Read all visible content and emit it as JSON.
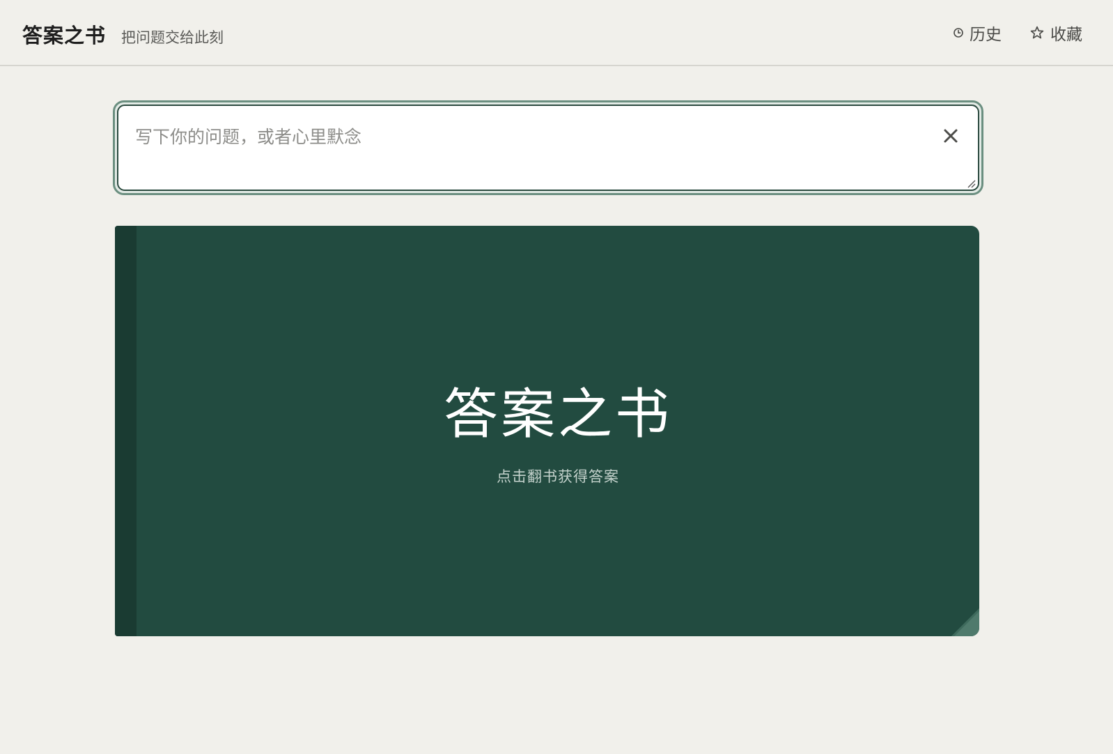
{
  "header": {
    "title": "答案之书",
    "tagline": "把问题交给此刻",
    "nav": [
      {
        "label": "历史",
        "icon": "clock-icon"
      },
      {
        "label": "收藏",
        "icon": "star-icon"
      }
    ]
  },
  "question": {
    "placeholder": "写下你的问题，或者心里默念",
    "value": "",
    "clear_icon": "close-icon"
  },
  "book": {
    "title": "答案之书",
    "hint": "点击翻书获得答案"
  },
  "colors": {
    "background": "#f1f0eb",
    "book_cover": "#224b40",
    "book_spine": "#1a3b32",
    "input_focus_ring": "#6b8f80"
  }
}
